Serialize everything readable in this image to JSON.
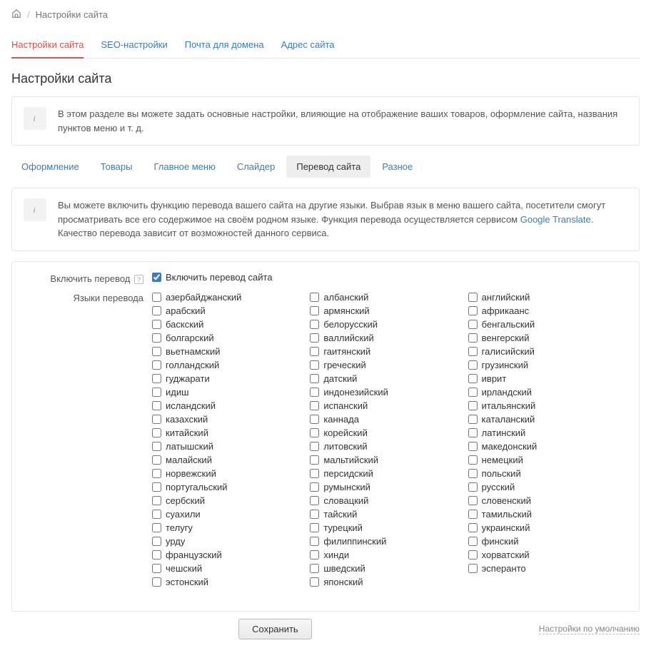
{
  "breadcrumb": {
    "home_icon": "home",
    "current": "Настройки сайта"
  },
  "primary_tabs": [
    {
      "label": "Настройки сайта",
      "active": true
    },
    {
      "label": "SEO-настройки",
      "active": false
    },
    {
      "label": "Почта для домена",
      "active": false
    },
    {
      "label": "Адрес сайта",
      "active": false
    }
  ],
  "page_title": "Настройки сайта",
  "info1": "В этом разделе вы можете задать основные настройки, влияющие на отображение ваших товаров, оформление сайта, названия пунктов меню и т. д.",
  "secondary_tabs": [
    {
      "label": "Оформление",
      "active": false
    },
    {
      "label": "Товары",
      "active": false
    },
    {
      "label": "Главное меню",
      "active": false
    },
    {
      "label": "Слайдер",
      "active": false
    },
    {
      "label": "Перевод сайта",
      "active": true
    },
    {
      "label": "Разное",
      "active": false
    }
  ],
  "info2_pre": "Вы можете включить функцию перевода вашего сайта на другие языки. Выбрав язык в меню вашего сайта, посетители смогут просматривать все его содержимое на своём родном языке. Функция перевода осуществляется сервисом ",
  "info2_link": "Google Translate",
  "info2_post": ". Качество перевода зависит от возможностей данного сервиса.",
  "form": {
    "enable_label": "Включить перевод",
    "enable_checkbox_label": "Включить перевод сайта",
    "enable_checked": true,
    "languages_label": "Языки перевода"
  },
  "languages": [
    "азербайджанский",
    "албанский",
    "английский",
    "арабский",
    "армянский",
    "африкаанс",
    "баскский",
    "белорусский",
    "бенгальский",
    "болгарский",
    "валлийский",
    "венгерский",
    "вьетнамский",
    "гаитянский",
    "галисийский",
    "голландский",
    "греческий",
    "грузинский",
    "гуджарати",
    "датский",
    "иврит",
    "идиш",
    "индонезийский",
    "ирландский",
    "исландский",
    "испанский",
    "итальянский",
    "казахский",
    "каннада",
    "каталанский",
    "китайский",
    "корейский",
    "латинский",
    "латышский",
    "литовский",
    "македонский",
    "малайский",
    "мальтийский",
    "немецкий",
    "норвежский",
    "персидский",
    "польский",
    "португальский",
    "румынский",
    "русский",
    "сербский",
    "словацкий",
    "словенский",
    "суахили",
    "тайский",
    "тамильский",
    "телугу",
    "турецкий",
    "украинский",
    "урду",
    "филиппинский",
    "финский",
    "французский",
    "хинди",
    "хорватский",
    "чешский",
    "шведский",
    "эсперанто",
    "эстонский",
    "японский"
  ],
  "save_button": "Сохранить",
  "defaults_link": "Настройки по умолчанию"
}
